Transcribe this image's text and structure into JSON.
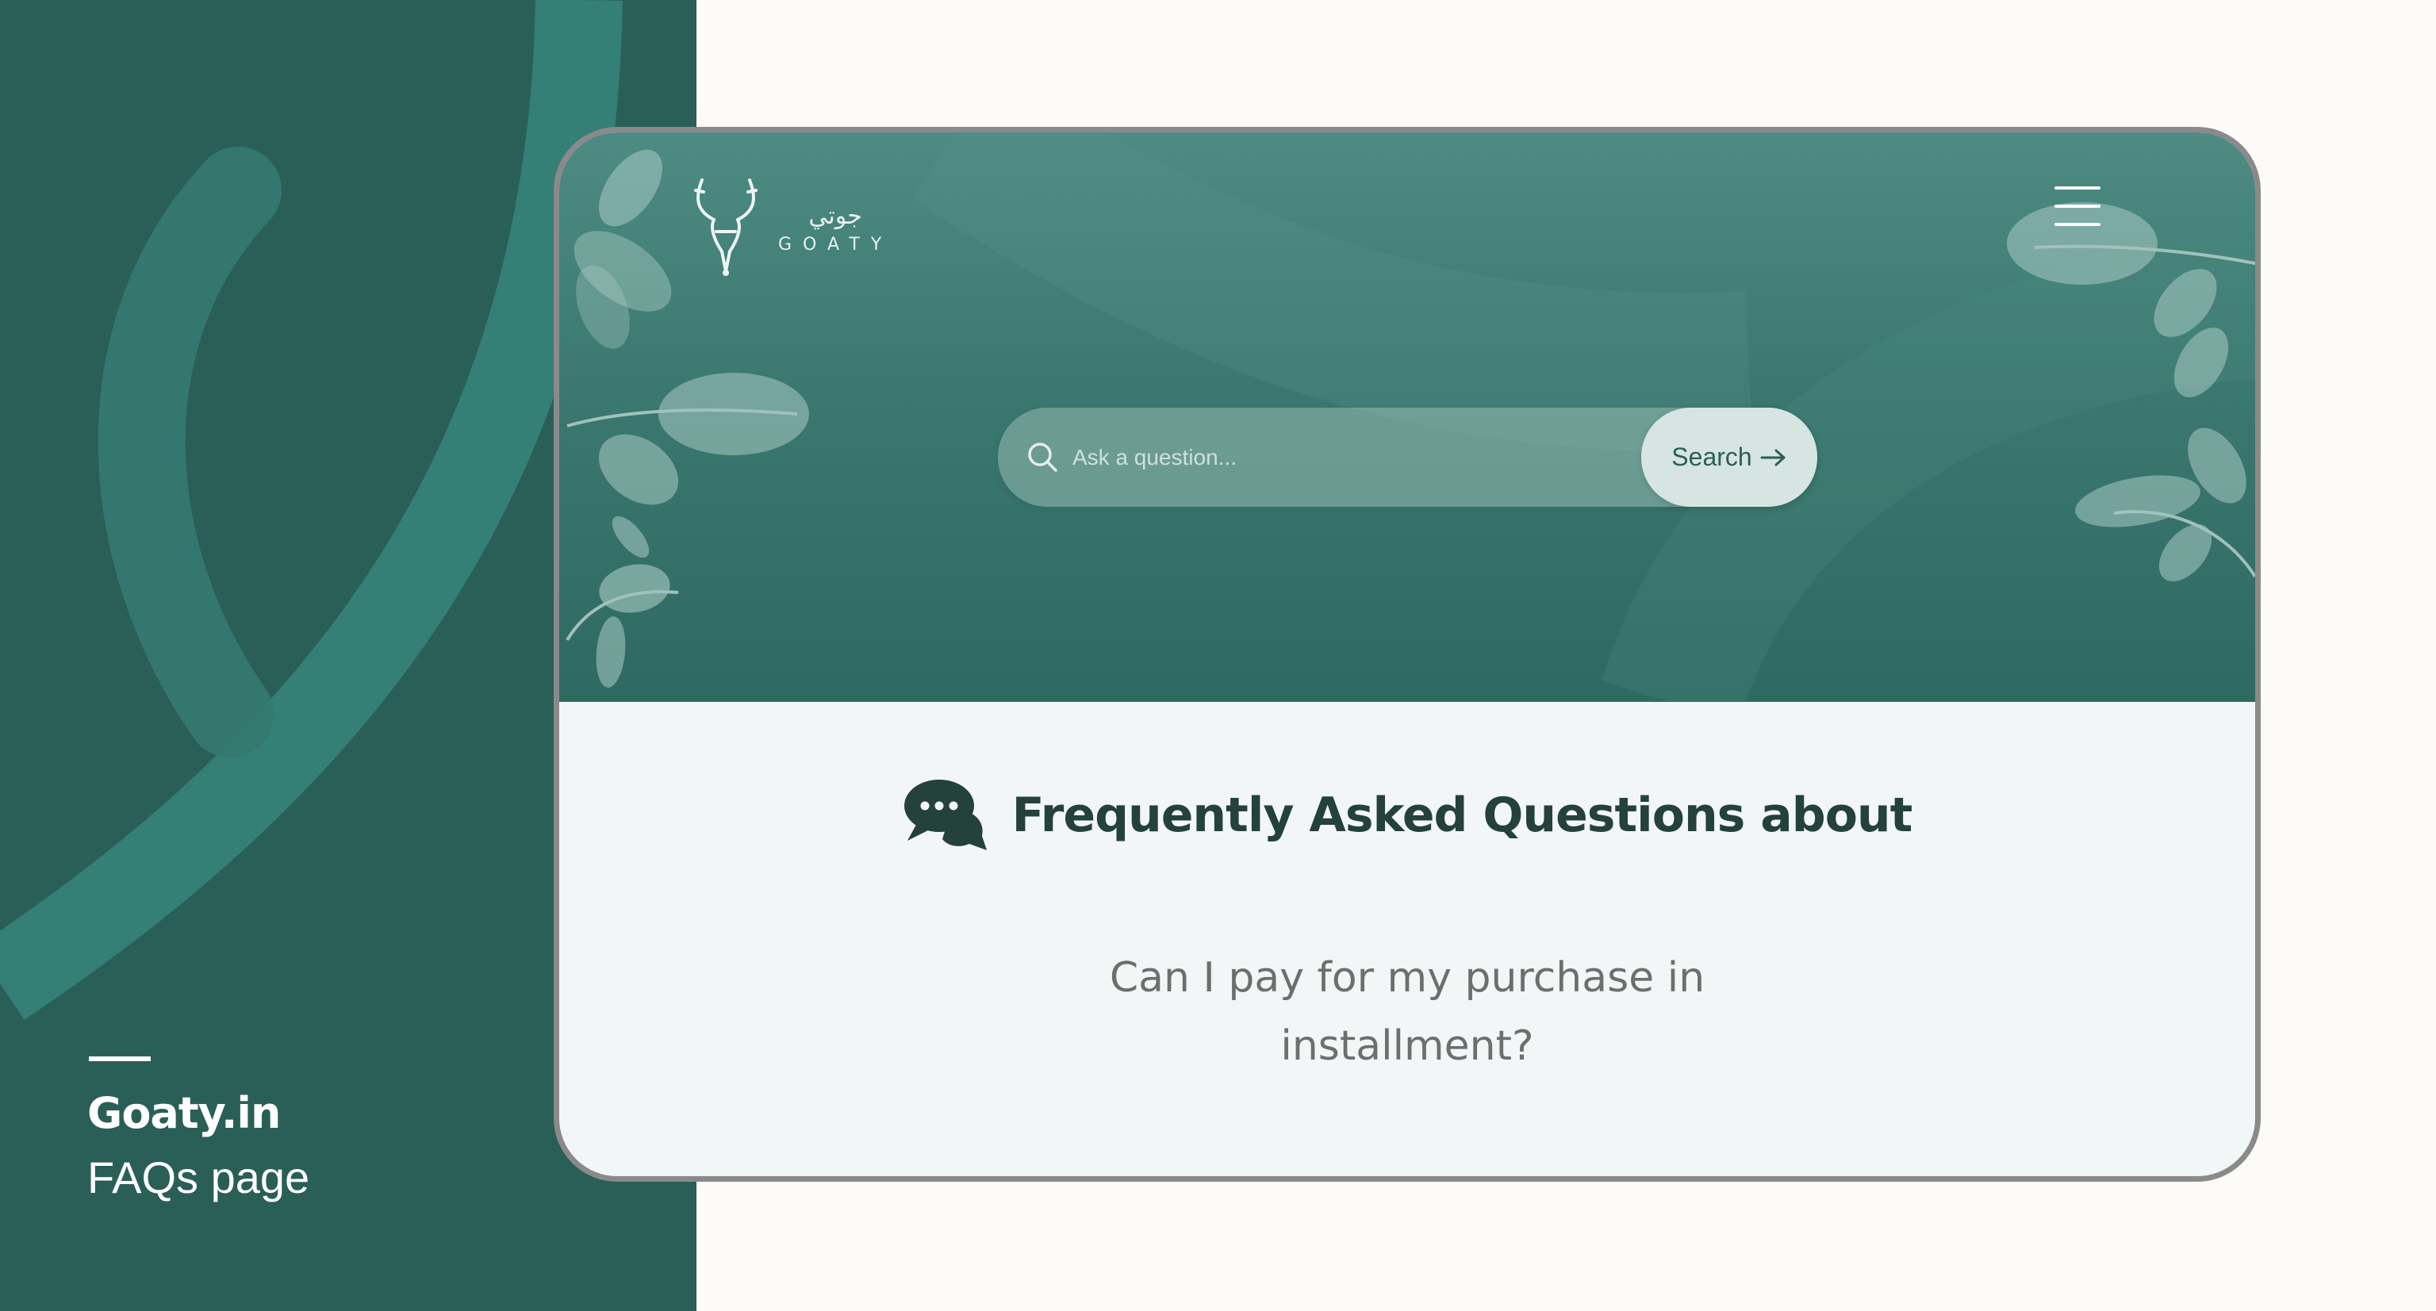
{
  "side": {
    "title": "Goaty.in",
    "subtitle": "FAQs page"
  },
  "brand": {
    "logo_arabic": "جوتي",
    "logo_latin": "GOATY",
    "logo_icon": "deer-head-icon"
  },
  "header": {
    "menu_icon": "hamburger-menu-icon"
  },
  "search": {
    "placeholder": "Ask a question...",
    "value": "",
    "button_label": "Search",
    "button_icon": "arrow-right-icon",
    "icon": "search-icon"
  },
  "faq": {
    "icon": "chat-bubbles-icon",
    "heading": "Frequently Asked Questions about",
    "questions": [
      {
        "text": "Can I pay for my purchase in installment?"
      }
    ]
  },
  "colors": {
    "panel_green": "#2a5f58",
    "hero_green": "#3b7870",
    "page_bg": "#fcfbf7",
    "content_bg": "#f2f6f6",
    "heading_text": "#24413c",
    "question_text": "#6b6f6e",
    "divider": "#9cc6c1"
  }
}
